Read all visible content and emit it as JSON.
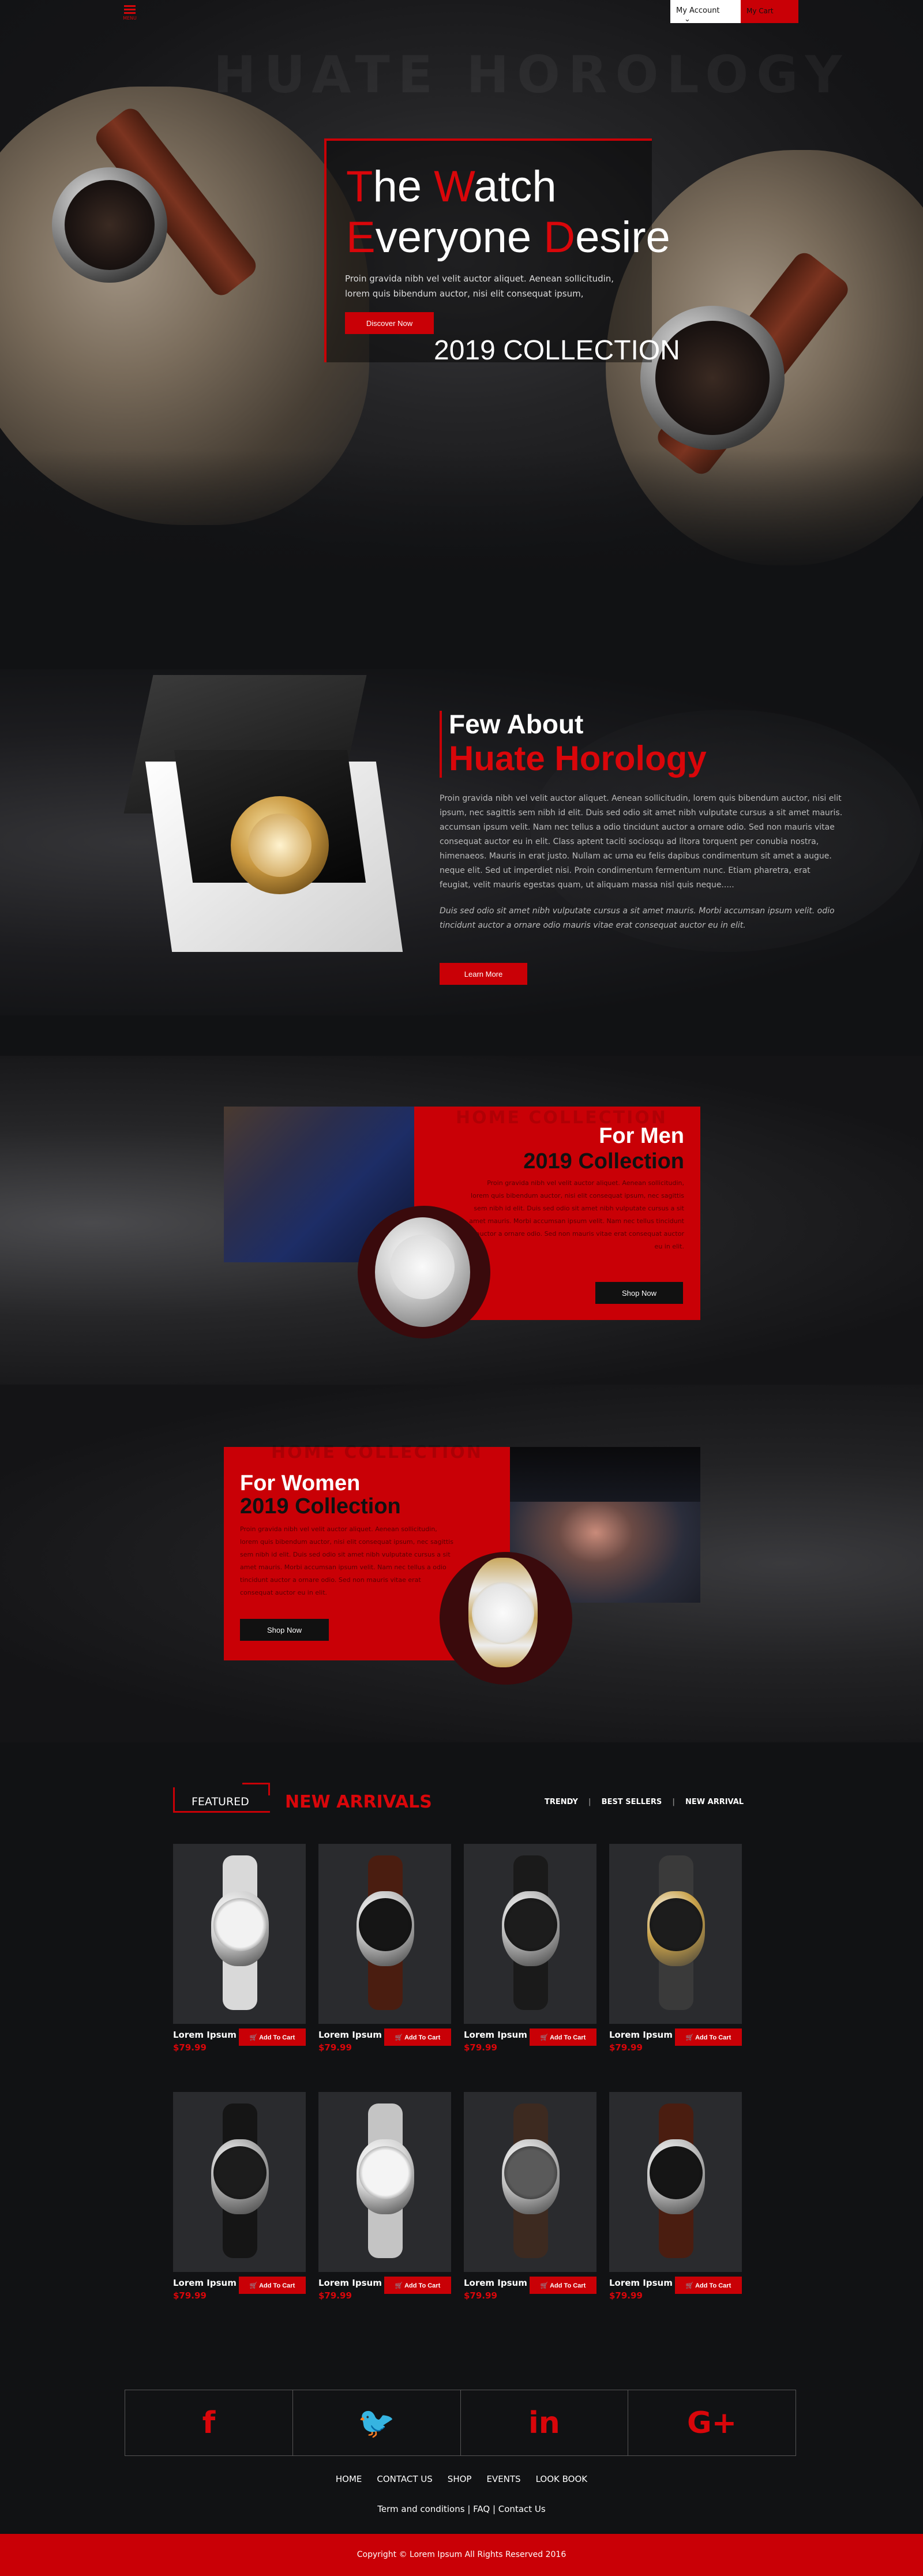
{
  "colors": {
    "accent": "#c90006",
    "background": "#111214",
    "card": "#2a2b2e"
  },
  "topbar": {
    "menu_label": "MENU",
    "account_label": "My Account",
    "account_chevron": "⌄",
    "cart_label": "My Cart"
  },
  "hero": {
    "bg_word": "HUATE HOROLOGY",
    "title_line1_first": "T",
    "title_line1_mid": "he ",
    "title_line1_red": "W",
    "title_line1_rest": "atch",
    "title_line2_first": "E",
    "title_line2_mid": "veryone ",
    "title_line2_red": "D",
    "title_line2_rest": "esire",
    "text": "Proin gravida nibh vel velit auctor aliquet. Aenean sollicitudin, lorem quis bibendum auctor, nisi elit consequat ipsum,",
    "button": "Discover Now",
    "collection": "2019 COLLECTION"
  },
  "about": {
    "heading1": "Few About",
    "heading2": "Huate Horology",
    "paragraph1": "Proin gravida nibh vel velit auctor aliquet. Aenean sollicitudin, lorem quis bibendum auctor, nisi elit ipsum, nec sagittis sem nibh id elit. Duis sed odio sit amet nibh vulputate cursus a sit amet mauris. accumsan ipsum velit. Nam nec tellus a odio tincidunt auctor a ornare odio. Sed non mauris vitae consequat auctor eu in elit. Class aptent taciti sociosqu ad litora torquent per conubia nostra, himenaeos. Mauris in erat justo. Nullam ac urna eu felis dapibus condimentum sit amet a augue. neque elit. Sed ut imperdiet nisi. Proin condimentum fermentum nunc. Etiam pharetra, erat feugiat, velit mauris egestas quam, ut aliquam massa nisl quis neque.....",
    "paragraph2": "Duis sed odio sit amet nibh vulputate cursus a sit amet mauris. Morbi accumsan ipsum velit. odio tincidunt auctor a ornare odio mauris vitae erat consequat auctor eu in elit.",
    "button": "Learn More"
  },
  "men": {
    "ghost": "HOME COLLECTION",
    "title": "For Men",
    "subtitle": "2019 Collection",
    "text": "Proin gravida nibh vel velit auctor aliquet. Aenean sollicitudin, lorem quis bibendum auctor, nisi elit consequat ipsum, nec sagittis sem nibh id elit. Duis sed odio sit amet nibh vulputate cursus a sit amet mauris. Morbi accumsan ipsum velit. Nam nec tellus tincidunt auctor a ornare odio. Sed non mauris vitae erat consequat auctor eu in elit.",
    "button": "Shop Now"
  },
  "women": {
    "ghost": "HOME COLLECTION",
    "title": "For Women",
    "subtitle": "2019 Collection",
    "text": "Proin gravida nibh vel velit auctor aliquet. Aenean sollicitudin, lorem quis bibendum auctor, nisi elit consequat ipsum, nec sagittis sem nibh id elit. Duis sed odio sit amet nibh vulputate cursus a sit amet mauris. Morbi accumsan ipsum velit. Nam nec tellus a odio tincidunt auctor a ornare odio. Sed non mauris vitae erat consequat auctor eu in elit.",
    "button": "Shop Now"
  },
  "featured": {
    "label": "FEATURED",
    "title": "NEW ARRIVALS",
    "tabs": [
      "TRENDY",
      "BEST SELLERS",
      "NEW ARRIVAL"
    ],
    "products": [
      {
        "name": "Lorem Ipsum",
        "price": "$79.99",
        "button": "Add To Cart",
        "strap": "#d9d9d9",
        "case": "#cfcfcf",
        "face": "#f2f2f2"
      },
      {
        "name": "Lorem Ipsum",
        "price": "$79.99",
        "button": "Add To Cart",
        "strap": "#4a1d10",
        "case": "#bdbdbd",
        "face": "#151515"
      },
      {
        "name": "Lorem Ipsum",
        "price": "$79.99",
        "button": "Add To Cart",
        "strap": "#1a1a1a",
        "case": "#b5b5b5",
        "face": "#1c1c1c"
      },
      {
        "name": "Lorem Ipsum",
        "price": "$79.99",
        "button": "Add To Cart",
        "strap": "#3a3a3a",
        "case": "#c9a24a",
        "face": "#1c1c1c"
      },
      {
        "name": "Lorem Ipsum",
        "price": "$79.99",
        "button": "Add To Cart",
        "strap": "#151515",
        "case": "#a9a9a9",
        "face": "#1c1c1c"
      },
      {
        "name": "Lorem Ipsum",
        "price": "$79.99",
        "button": "Add To Cart",
        "strap": "#c4c4c4",
        "case": "#d6d6d6",
        "face": "#f4f4f4"
      },
      {
        "name": "Lorem Ipsum",
        "price": "$79.99",
        "button": "Add To Cart",
        "strap": "#3d2a20",
        "case": "#bfbfbf",
        "face": "#5a5a5a"
      },
      {
        "name": "Lorem Ipsum",
        "price": "$79.99",
        "button": "Add To Cart",
        "strap": "#4a1d10",
        "case": "#bdbdbd",
        "face": "#151515"
      }
    ]
  },
  "footer": {
    "social": [
      "f",
      "🐦",
      "in",
      "G+"
    ],
    "nav": [
      "HOME",
      "CONTACT US",
      "SHOP",
      "EVENTS",
      "LOOK BOOK"
    ],
    "links": "Term and conditions | FAQ | Contact Us",
    "copyright": "Copyright © Lorem Ipsum All Rights Reserved 2016"
  }
}
